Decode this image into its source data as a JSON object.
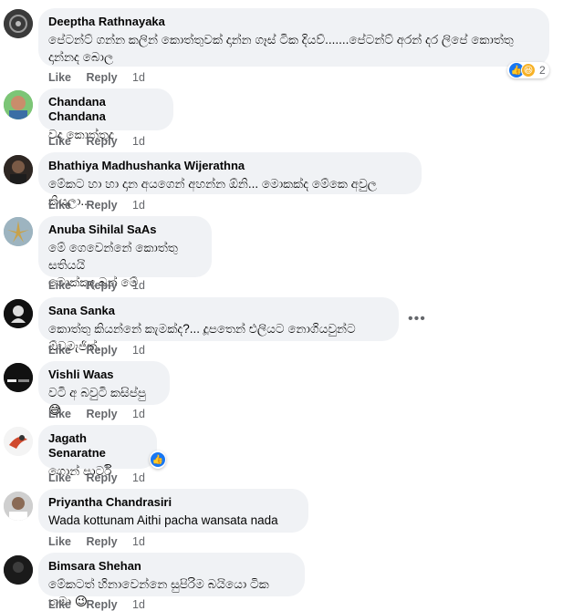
{
  "comments": [
    {
      "author": "Deeptha Rathnayaka",
      "text": "පේටන්ට් ගන්න කලින් කොත්තුවක් දාන්න ගෑස් ටික දියව්.......පේටන්ට් අරන් දර ලිපේ කොත්තු දාන්නද බොල",
      "like": "Like",
      "reply": "Reply",
      "time": "1d",
      "reaction_count": "2"
    },
    {
      "author": "Chandana Chandana",
      "text": "වද කොත්තුද",
      "like": "Like",
      "reply": "Reply",
      "time": "1d"
    },
    {
      "author": "Bhathiya Madhushanka Wijerathna",
      "text": "මේකට හා හා දාන අයගෙන් අහන්න ඕනි... මොකක්ද මේකෙ අවුල කියලා....",
      "like": "Like",
      "reply": "Reply",
      "time": "1d"
    },
    {
      "author": "Anuba Sihilal SaAs",
      "text": "මේ ගෙවෙන්නේ කොත්තු සතියයි\nමොක්කුද බන් මේ",
      "like": "Like",
      "reply": "Reply",
      "time": "1d"
    },
    {
      "author": "Sana Sanka",
      "text": "කොත්තු කියන්නේ කැමක්ද?... දූපතෙන් එලියට නොගියවුන්ට ඕවමැජික්.",
      "like": "Like",
      "reply": "Reply",
      "time": "1d",
      "more": "•••"
    },
    {
      "author": "Vishli Waas",
      "text": "වටි අ බවුටි කසිප්පු 😅",
      "like": "Like",
      "reply": "Reply",
      "time": "1d"
    },
    {
      "author": "Jagath Senaratne",
      "text": "ගොන් පාර්ටි",
      "like": "Like",
      "reply": "Reply",
      "time": "1d"
    },
    {
      "author": "Priyantha Chandrasiri",
      "text": "Wada kottunam Aithi pacha wansata nada",
      "like": "Like",
      "reply": "Reply",
      "time": "1d"
    },
    {
      "author": "Bimsara Shehan",
      "text": "මේකටත් හිනාවෙන්නෙ සුපිරිම බයියො ටික තමා 😉",
      "like": "Like",
      "reply": "Reply",
      "time": "1d"
    }
  ],
  "colors": {
    "bubble": "#f0f2f5",
    "meta": "#65676b",
    "like_blue": "#1877f2"
  }
}
